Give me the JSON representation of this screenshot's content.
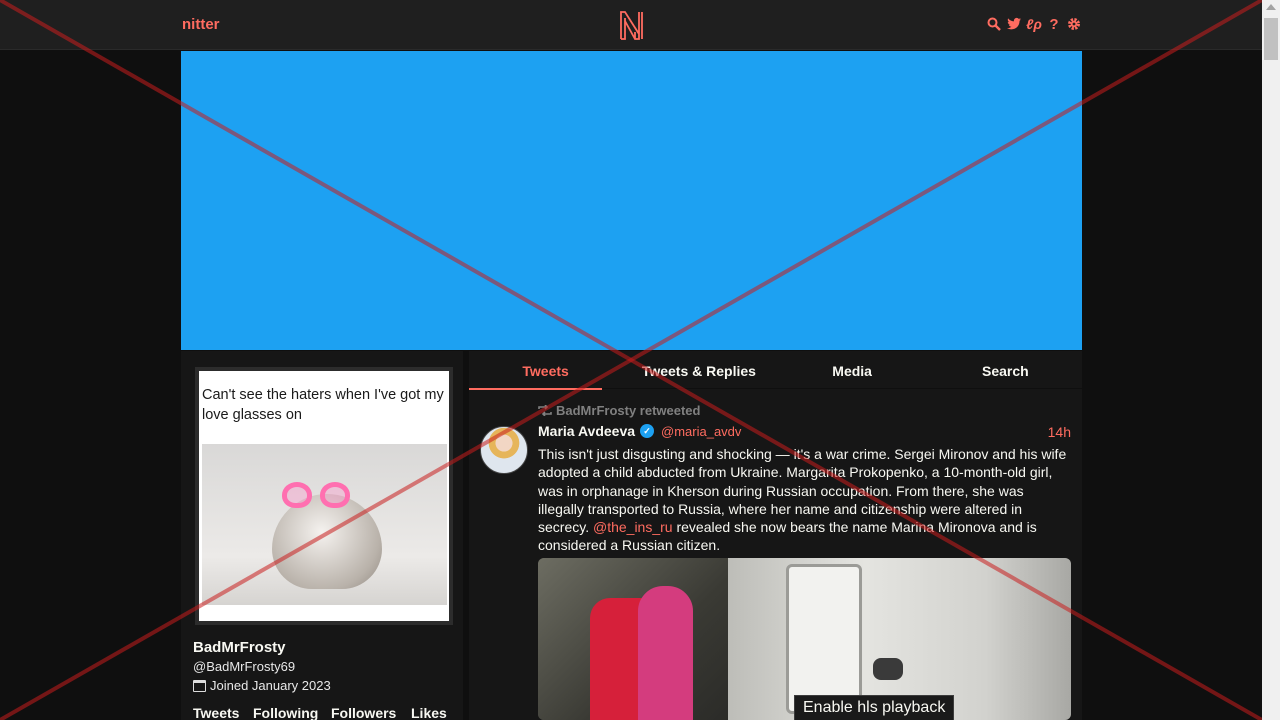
{
  "navbar": {
    "brand": "nitter",
    "logo_letter": "N",
    "icons": [
      "search-icon",
      "twitter-bird-icon",
      "rss-icon",
      "help-icon",
      "gear-icon"
    ],
    "icon_glyphs": [
      "🔍",
      "🐦",
      "ℓρ",
      "?",
      "⚙"
    ]
  },
  "banner": {
    "color": "#1da1f2"
  },
  "profile": {
    "avatar_caption": "Can't see the haters when I've got my love glasses on",
    "name": "BadMrFrosty",
    "handle": "@BadMrFrosty69",
    "joined": "Joined January 2023",
    "stats": [
      "Tweets",
      "Following",
      "Followers",
      "Likes"
    ]
  },
  "tabs": [
    {
      "label": "Tweets",
      "active": true
    },
    {
      "label": "Tweets & Replies",
      "active": false
    },
    {
      "label": "Media",
      "active": false
    },
    {
      "label": "Search",
      "active": false
    }
  ],
  "tweet": {
    "retweeted_by": "BadMrFrosty retweeted",
    "author_name": "Maria Avdeeva",
    "author_handle": "@maria_avdv",
    "time": "14h",
    "text_part1": "This isn't just disgusting and shocking — it's a war crime. Sergei Mironov and his wife adopted a child abducted from Ukraine. Margarita Prokopenko, a 10-month-old girl, was in orphanage in Kherson during Russian occupation. From there, she was illegally transported to Russia, where her name and citizenship were altered in secrecy. ",
    "mention": "@the_ins_ru",
    "text_part2": " revealed she now bears the name Marina Mironova and is considered a Russian citizen.",
    "media_button": "Enable hls playback"
  },
  "colors": {
    "accent": "#ff6c60",
    "background": "#0f0f0f",
    "panel": "#161616",
    "navbar": "#1f1f1f"
  }
}
